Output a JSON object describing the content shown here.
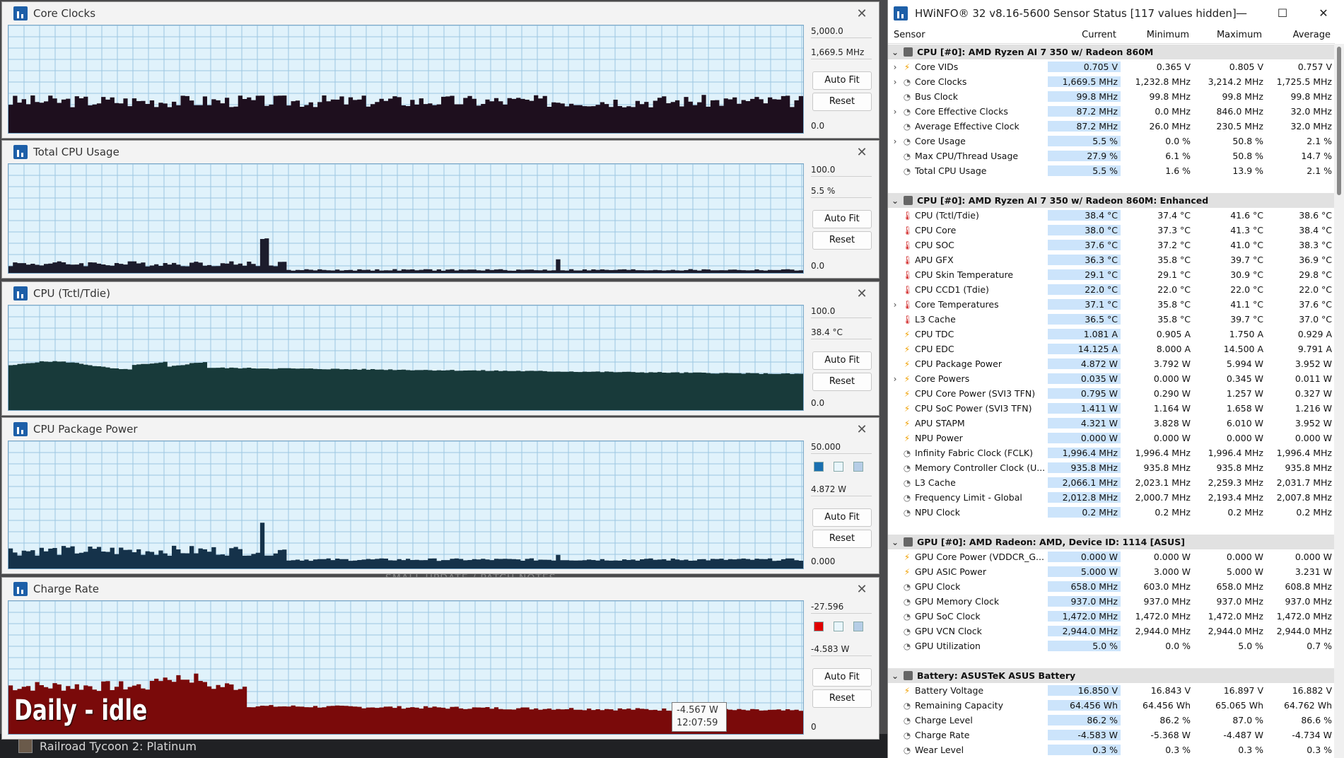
{
  "background": {
    "taskbar_app": "Railroad Tycoon 2: Platinum",
    "note": "SMALL UPDATE / PATCH NOTES"
  },
  "overlay_label": "Daily - idle",
  "tooltip": {
    "value": "-4.567 W",
    "time": "12:07:59"
  },
  "graphs": [
    {
      "title": "Core Clocks",
      "max_label": "5,000.0",
      "current": "1,669.5 MHz",
      "min_label": "0.0",
      "auto_fit": "Auto Fit",
      "reset": "Reset",
      "fill": "#1e0f1e",
      "level": 0.33,
      "profile": "flat"
    },
    {
      "title": "Total CPU Usage",
      "max_label": "100.0",
      "current": "5.5 %",
      "min_label": "0.0",
      "auto_fit": "Auto Fit",
      "reset": "Reset",
      "fill": "#1c1c2c",
      "level": 0.05,
      "profile": "spiky"
    },
    {
      "title": "CPU (Tctl/Tdie)",
      "max_label": "100.0",
      "current": "38.4 °C",
      "min_label": "0.0",
      "auto_fit": "Auto Fit",
      "reset": "Reset",
      "fill": "#183a3a",
      "level": 0.38,
      "profile": "temp"
    },
    {
      "title": "CPU Package Power",
      "max_label": "50.000",
      "current": "4.872 W",
      "min_label": "0.000",
      "auto_fit": "Auto Fit",
      "reset": "Reset",
      "fill": "#15324a",
      "level": 0.097,
      "profile": "power"
    },
    {
      "title": "Charge Rate",
      "max_label": "-27.596",
      "current": "-4.583 W",
      "min_label": "0",
      "auto_fit": "Auto Fit",
      "reset": "Reset",
      "fill": "#7a0a0a",
      "level": 0.17,
      "profile": "charge"
    }
  ],
  "colors": {
    "plot_bg": "#e0f2fb",
    "grid": "#9cc7e2",
    "accent": "#1d5fa8",
    "red_swatch": "#e00000",
    "blue_swatch": "#1a6fb0"
  },
  "hwinfo": {
    "title": "HWiNFO® 32 v8.16-5600 Sensor Status [117 values hidden]",
    "columns": {
      "sensor": "Sensor",
      "current": "Current",
      "minimum": "Minimum",
      "maximum": "Maximum",
      "average": "Average"
    },
    "rows": [
      {
        "type": "grp",
        "name": "CPU [#0]: AMD Ryzen AI 7 350 w/ Radeon 860M"
      },
      {
        "exp": true,
        "icon": "volt",
        "name": "Core VIDs",
        "cur": "0.705 V",
        "min": "0.365 V",
        "max": "0.805 V",
        "avg": "0.757 V"
      },
      {
        "exp": true,
        "icon": "clk",
        "name": "Core Clocks",
        "cur": "1,669.5 MHz",
        "min": "1,232.8 MHz",
        "max": "3,214.2 MHz",
        "avg": "1,725.5 MHz"
      },
      {
        "icon": "clk",
        "name": "Bus Clock",
        "cur": "99.8 MHz",
        "min": "99.8 MHz",
        "max": "99.8 MHz",
        "avg": "99.8 MHz"
      },
      {
        "exp": true,
        "icon": "clk",
        "name": "Core Effective Clocks",
        "cur": "87.2 MHz",
        "min": "0.0 MHz",
        "max": "846.0 MHz",
        "avg": "32.0 MHz"
      },
      {
        "icon": "clk",
        "name": "Average Effective Clock",
        "cur": "87.2 MHz",
        "min": "26.0 MHz",
        "max": "230.5 MHz",
        "avg": "32.0 MHz"
      },
      {
        "exp": true,
        "icon": "clk",
        "name": "Core Usage",
        "cur": "5.5 %",
        "min": "0.0 %",
        "max": "50.8 %",
        "avg": "2.1 %"
      },
      {
        "icon": "clk",
        "name": "Max CPU/Thread Usage",
        "cur": "27.9 %",
        "min": "6.1 %",
        "max": "50.8 %",
        "avg": "14.7 %"
      },
      {
        "icon": "clk",
        "name": "Total CPU Usage",
        "cur": "5.5 %",
        "min": "1.6 %",
        "max": "13.9 %",
        "avg": "2.1 %"
      },
      {
        "type": "blank"
      },
      {
        "type": "grp",
        "name": "CPU [#0]: AMD Ryzen AI 7 350 w/ Radeon 860M: Enhanced"
      },
      {
        "icon": "temp",
        "name": "CPU (Tctl/Tdie)",
        "cur": "38.4 °C",
        "min": "37.4 °C",
        "max": "41.6 °C",
        "avg": "38.6 °C"
      },
      {
        "icon": "temp",
        "name": "CPU Core",
        "cur": "38.0 °C",
        "min": "37.3 °C",
        "max": "41.3 °C",
        "avg": "38.4 °C"
      },
      {
        "icon": "temp",
        "name": "CPU SOC",
        "cur": "37.6 °C",
        "min": "37.2 °C",
        "max": "41.0 °C",
        "avg": "38.3 °C"
      },
      {
        "icon": "temp",
        "name": "APU GFX",
        "cur": "36.3 °C",
        "min": "35.8 °C",
        "max": "39.7 °C",
        "avg": "36.9 °C"
      },
      {
        "icon": "temp",
        "name": "CPU Skin Temperature",
        "cur": "29.1 °C",
        "min": "29.1 °C",
        "max": "30.9 °C",
        "avg": "29.8 °C"
      },
      {
        "icon": "temp",
        "name": "CPU CCD1 (Tdie)",
        "cur": "22.0 °C",
        "min": "22.0 °C",
        "max": "22.0 °C",
        "avg": "22.0 °C"
      },
      {
        "exp": true,
        "icon": "temp",
        "name": "Core Temperatures",
        "cur": "37.1 °C",
        "min": "35.8 °C",
        "max": "41.1 °C",
        "avg": "37.6 °C"
      },
      {
        "icon": "temp",
        "name": "L3 Cache",
        "cur": "36.5 °C",
        "min": "35.8 °C",
        "max": "39.7 °C",
        "avg": "37.0 °C"
      },
      {
        "icon": "volt",
        "name": "CPU TDC",
        "cur": "1.081 A",
        "min": "0.905 A",
        "max": "1.750 A",
        "avg": "0.929 A"
      },
      {
        "icon": "volt",
        "name": "CPU EDC",
        "cur": "14.125 A",
        "min": "8.000 A",
        "max": "14.500 A",
        "avg": "9.791 A"
      },
      {
        "icon": "volt",
        "name": "CPU Package Power",
        "cur": "4.872 W",
        "min": "3.792 W",
        "max": "5.994 W",
        "avg": "3.952 W"
      },
      {
        "exp": true,
        "icon": "volt",
        "name": "Core Powers",
        "cur": "0.035 W",
        "min": "0.000 W",
        "max": "0.345 W",
        "avg": "0.011 W"
      },
      {
        "icon": "volt",
        "name": "CPU Core Power (SVI3 TFN)",
        "cur": "0.795 W",
        "min": "0.290 W",
        "max": "1.257 W",
        "avg": "0.327 W"
      },
      {
        "icon": "volt",
        "name": "CPU SoC Power (SVI3 TFN)",
        "cur": "1.411 W",
        "min": "1.164 W",
        "max": "1.658 W",
        "avg": "1.216 W"
      },
      {
        "icon": "volt",
        "name": "APU STAPM",
        "cur": "4.321 W",
        "min": "3.828 W",
        "max": "6.010 W",
        "avg": "3.952 W"
      },
      {
        "icon": "volt",
        "name": "NPU Power",
        "cur": "0.000 W",
        "min": "0.000 W",
        "max": "0.000 W",
        "avg": "0.000 W"
      },
      {
        "icon": "clk",
        "name": "Infinity Fabric Clock (FCLK)",
        "cur": "1,996.4 MHz",
        "min": "1,996.4 MHz",
        "max": "1,996.4 MHz",
        "avg": "1,996.4 MHz"
      },
      {
        "icon": "clk",
        "name": "Memory Controller Clock (U...",
        "cur": "935.8 MHz",
        "min": "935.8 MHz",
        "max": "935.8 MHz",
        "avg": "935.8 MHz"
      },
      {
        "icon": "clk",
        "name": "L3 Cache",
        "cur": "2,066.1 MHz",
        "min": "2,023.1 MHz",
        "max": "2,259.3 MHz",
        "avg": "2,031.7 MHz"
      },
      {
        "icon": "clk",
        "name": "Frequency Limit - Global",
        "cur": "2,012.8 MHz",
        "min": "2,000.7 MHz",
        "max": "2,193.4 MHz",
        "avg": "2,007.8 MHz"
      },
      {
        "icon": "clk",
        "name": "NPU Clock",
        "cur": "0.2 MHz",
        "min": "0.2 MHz",
        "max": "0.2 MHz",
        "avg": "0.2 MHz"
      },
      {
        "type": "blank"
      },
      {
        "type": "grp",
        "name": "GPU [#0]: AMD Radeon: AMD, Device ID: 1114 [ASUS]"
      },
      {
        "icon": "volt",
        "name": "GPU Core Power (VDDCR_G...",
        "cur": "0.000 W",
        "min": "0.000 W",
        "max": "0.000 W",
        "avg": "0.000 W"
      },
      {
        "icon": "volt",
        "name": "GPU ASIC Power",
        "cur": "5.000 W",
        "min": "3.000 W",
        "max": "5.000 W",
        "avg": "3.231 W"
      },
      {
        "icon": "clk",
        "name": "GPU Clock",
        "cur": "658.0 MHz",
        "min": "603.0 MHz",
        "max": "658.0 MHz",
        "avg": "608.8 MHz"
      },
      {
        "icon": "clk",
        "name": "GPU Memory Clock",
        "cur": "937.0 MHz",
        "min": "937.0 MHz",
        "max": "937.0 MHz",
        "avg": "937.0 MHz"
      },
      {
        "icon": "clk",
        "name": "GPU SoC Clock",
        "cur": "1,472.0 MHz",
        "min": "1,472.0 MHz",
        "max": "1,472.0 MHz",
        "avg": "1,472.0 MHz"
      },
      {
        "icon": "clk",
        "name": "GPU VCN Clock",
        "cur": "2,944.0 MHz",
        "min": "2,944.0 MHz",
        "max": "2,944.0 MHz",
        "avg": "2,944.0 MHz"
      },
      {
        "icon": "clk",
        "name": "GPU Utilization",
        "cur": "5.0 %",
        "min": "0.0 %",
        "max": "5.0 %",
        "avg": "0.7 %"
      },
      {
        "type": "blank"
      },
      {
        "type": "grp",
        "name": "Battery: ASUSTeK ASUS Battery"
      },
      {
        "icon": "volt",
        "name": "Battery Voltage",
        "cur": "16.850 V",
        "min": "16.843 V",
        "max": "16.897 V",
        "avg": "16.882 V"
      },
      {
        "icon": "clk",
        "name": "Remaining Capacity",
        "cur": "64.456 Wh",
        "min": "64.456 Wh",
        "max": "65.065 Wh",
        "avg": "64.762 Wh"
      },
      {
        "icon": "clk",
        "name": "Charge Level",
        "cur": "86.2 %",
        "min": "86.2 %",
        "max": "87.0 %",
        "avg": "86.6 %"
      },
      {
        "icon": "clk",
        "name": "Charge Rate",
        "cur": "-4.583 W",
        "min": "-5.368 W",
        "max": "-4.487 W",
        "avg": "-4.734 W"
      },
      {
        "icon": "clk",
        "name": "Wear Level",
        "cur": "0.3 %",
        "min": "0.3 %",
        "max": "0.3 %",
        "avg": "0.3 %"
      }
    ]
  }
}
